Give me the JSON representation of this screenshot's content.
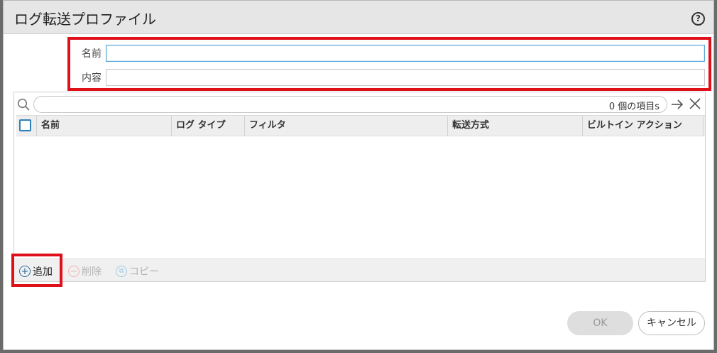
{
  "dialog": {
    "title": "ログ転送プロファイル",
    "help_icon": "question-mark-icon"
  },
  "form": {
    "name_label": "名前",
    "name_value": "",
    "description_label": "内容",
    "description_value": ""
  },
  "search": {
    "count_text": "0 個の項目s"
  },
  "table": {
    "columns": [
      "名前",
      "ログ タイプ",
      "フィルタ",
      "転送方式",
      "ビルトイン アクション"
    ],
    "rows": []
  },
  "toolbar": {
    "add_label": "追加",
    "delete_label": "削除",
    "copy_label": "コピー"
  },
  "buttons": {
    "ok_label": "OK",
    "cancel_label": "キャンセル"
  },
  "colors": {
    "highlight": "#e0101b",
    "accent": "#2d7fb9"
  }
}
